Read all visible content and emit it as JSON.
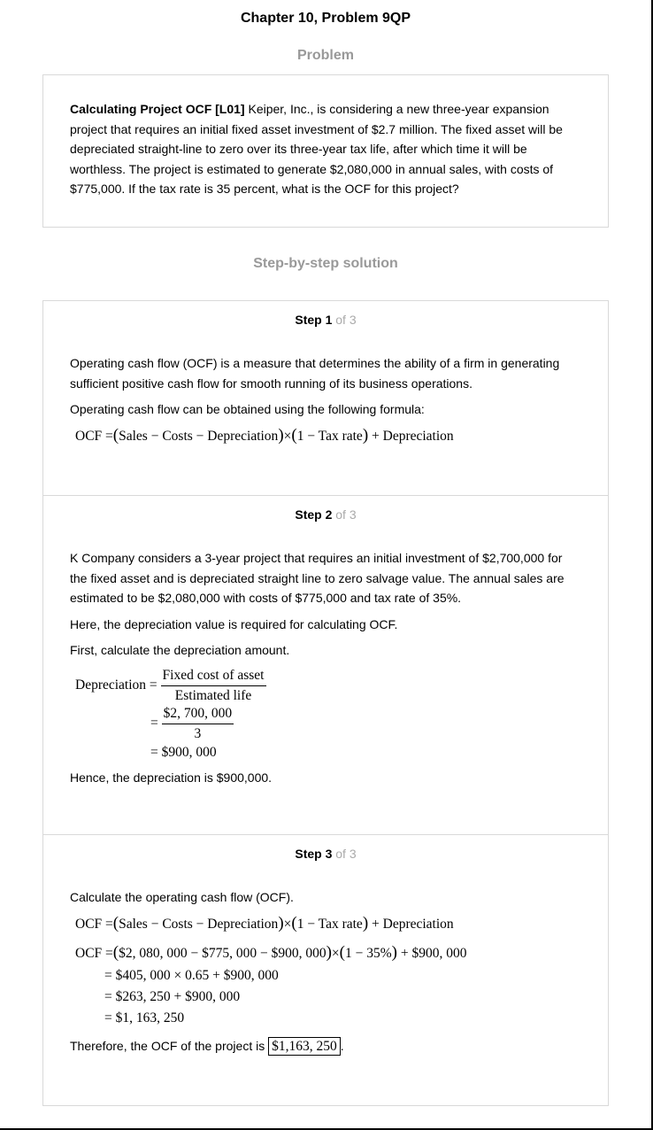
{
  "page": {
    "title": "Chapter 10, Problem 9QP",
    "problem_heading": "Problem",
    "solution_heading": "Step-by-step solution"
  },
  "problem": {
    "bold_lead": "Calculating Project OCF [L01]",
    "lines": [
      " Keiper, Inc., is considering a new three-year expansion",
      "project that requires an initial fixed asset investment of $2.7 million. The fixed asset will be",
      "depreciated straight-line to zero over its three-year tax life, after which time it will be",
      "worthless. The project is estimated to generate $2,080,000 in annual sales, with costs of",
      "$775,000. If the tax rate is 35 percent, what is the OCF for this project?"
    ]
  },
  "steps": [
    {
      "label": "Step 1",
      "of": "of 3",
      "text_lines": [
        "Operating cash flow (OCF) is a measure that determines the ability of a firm in generating",
        "sufficient positive cash flow for smooth running of its business operations."
      ],
      "text2": "Operating cash flow can be obtained using the following formula:",
      "formula": {
        "lhs": "OCF",
        "eq": "=",
        "group1": "Sales − Costs − Depreciation",
        "times": "×",
        "group2": "1 − Tax rate",
        "plus": "+ Depreciation"
      }
    },
    {
      "label": "Step 2",
      "of": "of 3",
      "text_lines": [
        "K Company considers a 3-year project that requires an initial investment of $2,700,000 for",
        "the fixed asset and is depreciated straight line to zero salvage value. The annual sales are",
        "estimated to be $2,080,000 with costs of $775,000 and tax rate of 35%."
      ],
      "text2": "Here, the depreciation value is required for calculating OCF.",
      "text3": "First, calculate the depreciation amount.",
      "calc": {
        "lhs": "Depreciation",
        "eq": "=",
        "frac1_num": "Fixed cost of asset",
        "frac1_den": "Estimated life",
        "frac2_num": "$2, 700, 000",
        "frac2_den": "3",
        "result": "= $900, 000"
      },
      "conclusion": "Hence, the depreciation is $900,000."
    },
    {
      "label": "Step 3",
      "of": "of 3",
      "text": "Calculate the operating cash flow (OCF).",
      "formula": {
        "lhs": "OCF",
        "eq": "=",
        "group1": "Sales − Costs − Depreciation",
        "times": "×",
        "group2": "1 − Tax rate",
        "plus": "+ Depreciation"
      },
      "calc": {
        "lhs": "OCF",
        "eq": "=",
        "group1": "$2, 080, 000 − $775, 000 − $900, 000",
        "times": "×",
        "group2": "1 − 35%",
        "plus": "+ $900, 000",
        "line2": "= $405, 000 × 0.65 + $900, 000",
        "line3": "= $263, 250 + $900, 000",
        "line4": "= $1, 163, 250"
      },
      "conclusion_prefix": "Therefore, the OCF of the project is",
      "answer": "$1,163, 250",
      "conclusion_suffix": "."
    }
  ]
}
